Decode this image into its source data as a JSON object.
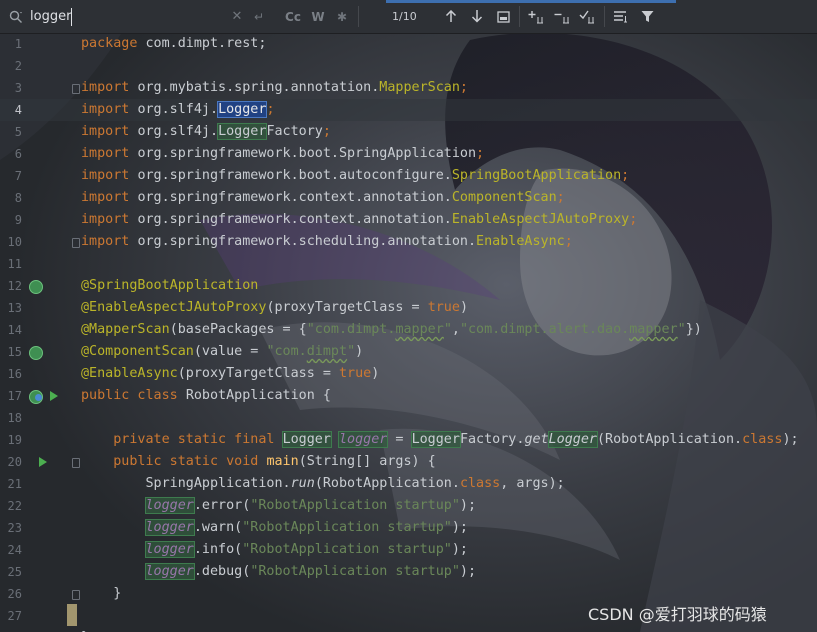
{
  "search": {
    "query": "logger",
    "match_count": "1/10"
  },
  "code_lines": [
    "package com.dimpt.rest;",
    "",
    "import org.mybatis.spring.annotation.MapperScan;",
    "import org.slf4j.Logger;",
    "import org.slf4j.LoggerFactory;",
    "import org.springframework.boot.SpringApplication;",
    "import org.springframework.boot.autoconfigure.SpringBootApplication;",
    "import org.springframework.context.annotation.ComponentScan;",
    "import org.springframework.context.annotation.EnableAspectJAutoProxy;",
    "import org.springframework.scheduling.annotation.EnableAsync;",
    "",
    "@SpringBootApplication",
    "@EnableAspectJAutoProxy(proxyTargetClass = true)",
    "@MapperScan(basePackages = {\"com.dimpt.mapper\",\"com.dimpt.alert.dao.mapper\"})",
    "@ComponentScan(value = \"com.dimpt\")",
    "@EnableAsync(proxyTargetClass = true)",
    "public class RobotApplication {",
    "",
    "    private static final Logger logger = LoggerFactory.getLogger(RobotApplication.class);",
    "    public static void main(String[] args) {",
    "        SpringApplication.run(RobotApplication.class, args);",
    "        logger.error(\"RobotApplication startup\");",
    "        logger.warn(\"RobotApplication startup\");",
    "        logger.info(\"RobotApplication startup\");",
    "        logger.debug(\"RobotApplication startup\");",
    "    }",
    "",
    "}"
  ],
  "line_numbers": [
    "1",
    "2",
    "3",
    "4",
    "5",
    "6",
    "7",
    "8",
    "9",
    "10",
    "11",
    "12",
    "13",
    "14",
    "15",
    "16",
    "17",
    "18",
    "19",
    "20",
    "21",
    "22",
    "23",
    "24",
    "25",
    "26",
    "27"
  ],
  "current_line": "4",
  "icons": {
    "search": "search-icon",
    "clear": "clear-icon",
    "newline": "new-line-icon",
    "match_case": "match-case-icon",
    "words": "words-icon",
    "regex": "regex-icon",
    "prev": "arrow-up-icon",
    "next": "arrow-down-icon",
    "select_all": "select-all-occurrences-icon",
    "add_selection": "add-selection-icon",
    "remove_selection": "remove-selection-icon",
    "select_all_occurrences": "select-all-icon",
    "filter_options": "filter-options-icon",
    "filter": "filter-icon"
  },
  "toolbar": {
    "match_case_label": "Cc",
    "words_label": "W"
  },
  "watermark": "CSDN @爱打羽球的码猿",
  "colors": {
    "keyword": "#cc7832",
    "annotation": "#bbb529",
    "string": "#6a8759",
    "method": "#ffc66d",
    "match_highlight": "#32593d",
    "current_match": "#214283"
  }
}
